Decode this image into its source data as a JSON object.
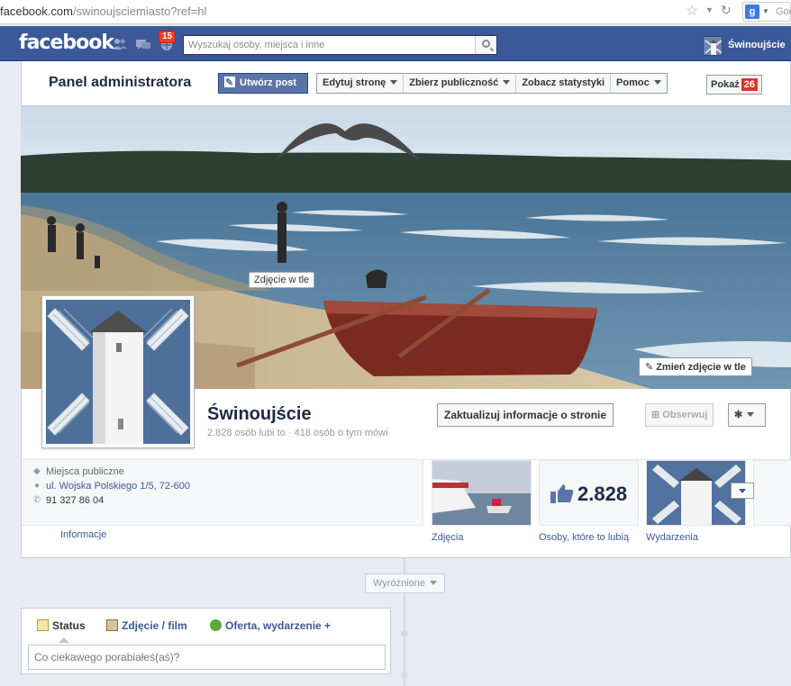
{
  "browser": {
    "url_host": "facebook.com",
    "url_path": "/swinoujsciemiasto?ref=hl",
    "search_text": "Goo"
  },
  "topbar": {
    "logo": "facebook",
    "notifications_count": "15",
    "search_placeholder": "Wyszukaj osoby, miejsca i inne",
    "page_name": "Świnoujście"
  },
  "admin": {
    "title": "Panel administratora",
    "create_post": "Utwórz post",
    "menu": [
      "Edytuj stronę",
      "Zbierz publiczność",
      "Zobacz statystyki",
      "Pomoc"
    ],
    "show_label": "Pokaż",
    "show_count": "26"
  },
  "cover": {
    "label": "Zdjęcie w tle",
    "change_label": "Zmień zdjęcie w tle"
  },
  "page": {
    "name": "Świnoujście",
    "stats": "2.828 osób lubi to · 418 osób o tym mówi",
    "update_button": "Zaktualizuj informacje o stronie",
    "follow_button": "Obserwuj"
  },
  "info": {
    "category": "Miejsca publiczne",
    "address": "ul. Wojska Polskiego 1/5, 72-600",
    "phone": "91 327 86 04",
    "link": "Informacje"
  },
  "tiles": {
    "photos_label": "Zdjęcia",
    "likes_count": "2.828",
    "likes_label": "Osoby, które to lubią",
    "events_label": "Wydarzenia"
  },
  "timeline": {
    "featured": "Wyróżnione"
  },
  "composer": {
    "tabs": [
      "Status",
      "Zdjęcie / film",
      "Oferta, wydarzenie +"
    ],
    "placeholder": "Co ciekawego porabiałeś(aś)?"
  },
  "colors": {
    "fb_blue": "#3b5998",
    "badge_red": "#f03d25"
  }
}
